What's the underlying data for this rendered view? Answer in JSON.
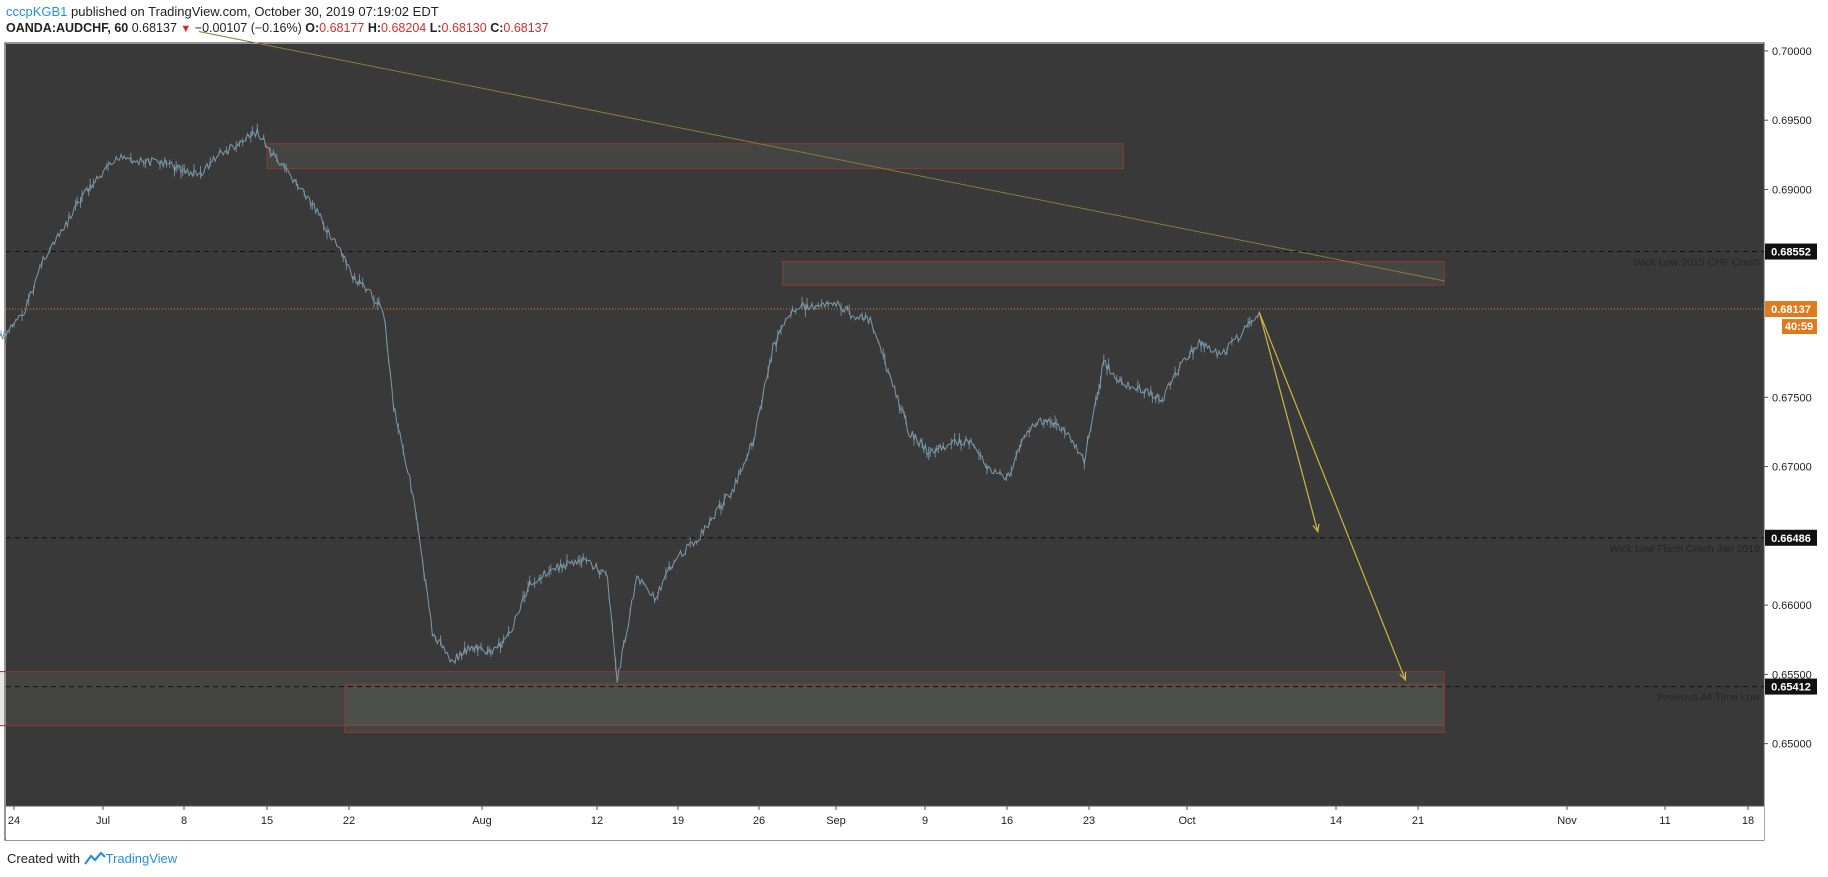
{
  "header": {
    "author": "cccpKGB1",
    "published_text": "published on TradingView.com, October 30, 2019 07:19:02 EDT",
    "symbol": "OANDA:AUDCHF, 60",
    "last": "0.68137",
    "change": "−0.00107 (−0.16%)",
    "o_label": "O:",
    "o_value": "0.68177",
    "h_label": "H:",
    "h_value": "0.68204",
    "l_label": "L:",
    "l_value": "0.68130",
    "c_label": "C:",
    "c_value": "0.68137"
  },
  "footer": {
    "created_with": "Created with",
    "brand": "TradingView"
  },
  "chart_data": {
    "type": "line",
    "ylim": [
      0.6455,
      0.7005
    ],
    "y_ticks": [
      {
        "value": 0.7,
        "label": "0.70000"
      },
      {
        "value": 0.695,
        "label": "0.69500"
      },
      {
        "value": 0.69,
        "label": "0.69000"
      },
      {
        "value": 0.675,
        "label": "0.67500"
      },
      {
        "value": 0.67,
        "label": "0.67000"
      },
      {
        "value": 0.66,
        "label": "0.66000"
      },
      {
        "value": 0.655,
        "label": "0.65500"
      },
      {
        "value": 0.65,
        "label": "0.65000"
      }
    ],
    "x_ticks": [
      "24",
      "Jul",
      "8",
      "15",
      "22",
      "Aug",
      "12",
      "19",
      "26",
      "Sep",
      "9",
      "16",
      "23",
      "Oct",
      "14",
      "21",
      "Nov",
      "11",
      "18"
    ],
    "price_tags": [
      {
        "value": 0.68552,
        "label": "0.68552",
        "style": "dark"
      },
      {
        "value": 0.68137,
        "label": "0.68137",
        "style": "orange"
      },
      {
        "value": 0.66486,
        "label": "0.66486",
        "style": "dark"
      },
      {
        "value": 0.65412,
        "label": "0.65412",
        "style": "dark"
      }
    ],
    "countdown": "40:59",
    "horizontal_lines": [
      {
        "value": 0.68552,
        "label": "Wick Low 2015 CHF Crash"
      },
      {
        "value": 0.66486,
        "label": "Wick Low Flash Crash Jan 2019"
      },
      {
        "value": 0.65412,
        "label": "Previous All Time Low"
      }
    ],
    "zones": [
      {
        "from_date": "2019-07-20",
        "to_date": "2019-10-16",
        "low": 0.6915,
        "high": 0.6933
      },
      {
        "from_date": "2019-09-11",
        "to_date": "2019-11-18",
        "low": 0.6831,
        "high": 0.6848
      },
      {
        "from_date": "2019-06-22",
        "to_date": "2019-11-18",
        "low": 0.6513,
        "high": 0.6552
      },
      {
        "from_date": "2019-07-28",
        "to_date": "2019-11-18",
        "low": 0.6508,
        "high": 0.6543
      }
    ],
    "trendline": {
      "from": [
        "2019-07-13",
        0.7014
      ],
      "to": [
        "2019-11-18",
        0.6834
      ]
    },
    "projections": [
      {
        "from": [
          "2019-10-30",
          0.6811
        ],
        "to": [
          "2019-11-05",
          0.6653
        ]
      },
      {
        "from": [
          "2019-10-30",
          0.6811
        ],
        "to": [
          "2019-11-14",
          0.6546
        ]
      }
    ],
    "series": [
      {
        "x": [
          "2019-06-21",
          "2019-06-23",
          "2019-06-25",
          "2019-06-27",
          "2019-06-29",
          "2019-07-01",
          "2019-07-03",
          "2019-07-05",
          "2019-07-07",
          "2019-07-09",
          "2019-07-11",
          "2019-07-13",
          "2019-07-15",
          "2019-07-17",
          "2019-07-19",
          "2019-07-21",
          "2019-07-23",
          "2019-07-25",
          "2019-07-27",
          "2019-07-29",
          "2019-07-31",
          "2019-08-01",
          "2019-08-02",
          "2019-08-04",
          "2019-08-06",
          "2019-08-08",
          "2019-08-10",
          "2019-08-12",
          "2019-08-14",
          "2019-08-16",
          "2019-08-18",
          "2019-08-20",
          "2019-08-22",
          "2019-08-24",
          "2019-08-25",
          "2019-08-27",
          "2019-08-29",
          "2019-08-31",
          "2019-09-02",
          "2019-09-04",
          "2019-09-06",
          "2019-09-08",
          "2019-09-10",
          "2019-09-12",
          "2019-09-14",
          "2019-09-16",
          "2019-09-18",
          "2019-09-20",
          "2019-09-22",
          "2019-09-24",
          "2019-09-26",
          "2019-09-28",
          "2019-09-30",
          "2019-10-02",
          "2019-10-04",
          "2019-10-06",
          "2019-10-08",
          "2019-10-10",
          "2019-10-12",
          "2019-10-14",
          "2019-10-16",
          "2019-10-18",
          "2019-10-20",
          "2019-10-22",
          "2019-10-24",
          "2019-10-26",
          "2019-10-28",
          "2019-10-30"
        ],
        "values": [
          0.679,
          0.6795,
          0.681,
          0.685,
          0.687,
          0.6895,
          0.691,
          0.6925,
          0.692,
          0.692,
          0.6915,
          0.691,
          0.6925,
          0.6932,
          0.6942,
          0.692,
          0.6905,
          0.6885,
          0.6862,
          0.6835,
          0.6822,
          0.6812,
          0.6745,
          0.668,
          0.658,
          0.656,
          0.657,
          0.6565,
          0.658,
          0.6615,
          0.6625,
          0.663,
          0.6632,
          0.662,
          0.6545,
          0.662,
          0.6605,
          0.6635,
          0.6645,
          0.6665,
          0.6685,
          0.672,
          0.6785,
          0.6815,
          0.6815,
          0.682,
          0.681,
          0.6805,
          0.6765,
          0.6725,
          0.671,
          0.6715,
          0.672,
          0.67,
          0.669,
          0.6725,
          0.6735,
          0.6725,
          0.6705,
          0.6775,
          0.676,
          0.6755,
          0.6748,
          0.6775,
          0.679,
          0.678,
          0.6795,
          0.6812
        ]
      }
    ]
  }
}
